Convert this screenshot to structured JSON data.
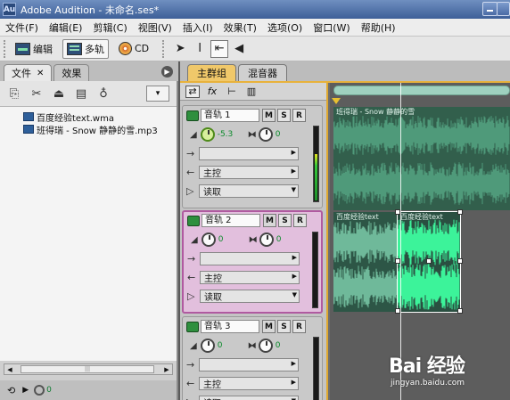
{
  "window": {
    "title": "Adobe Audition - 未命名.ses*",
    "app_icon": "Au"
  },
  "menu": [
    "文件(F)",
    "编辑(E)",
    "剪辑(C)",
    "视图(V)",
    "插入(I)",
    "效果(T)",
    "选项(O)",
    "窗口(W)",
    "帮助(H)"
  ],
  "toolbar": {
    "edit_label": "编辑",
    "multitrack_label": "多轨",
    "cd_label": "CD"
  },
  "left_panel": {
    "tab_files": "文件",
    "tab_effects": "效果",
    "files": [
      "百度经验text.wma",
      "班得瑞 - Snow 静静的雪.mp3"
    ],
    "bottom_value": "0"
  },
  "main": {
    "tab_main_group": "主群组",
    "tab_mixer": "混音器"
  },
  "tracks": [
    {
      "name": "音轨 1",
      "volume": "-5.3",
      "pan": "0",
      "output": "主控",
      "automation": "读取",
      "meter_level": 0.62,
      "selected": false
    },
    {
      "name": "音轨 2",
      "volume": "0",
      "pan": "0",
      "output": "主控",
      "automation": "读取",
      "meter_level": 0.0,
      "selected": true
    },
    {
      "name": "音轨 3",
      "volume": "0",
      "pan": "0",
      "output": "主控",
      "automation": "读取",
      "meter_level": 0.0,
      "selected": false
    }
  ],
  "clips": {
    "track1_label": "班得瑞 - Snow 静静的雪",
    "track2_label_a": "百度经验text",
    "track2_label_b": "百度经验text"
  },
  "colors": {
    "accent_gold": "#e8b23c",
    "selected_track": "#b05aa0",
    "wave_green": "#3cf39a",
    "clip_bg": "#325f4c"
  },
  "watermark": {
    "logo": "Bai 经验",
    "url": "jingyan.baidu.com"
  }
}
